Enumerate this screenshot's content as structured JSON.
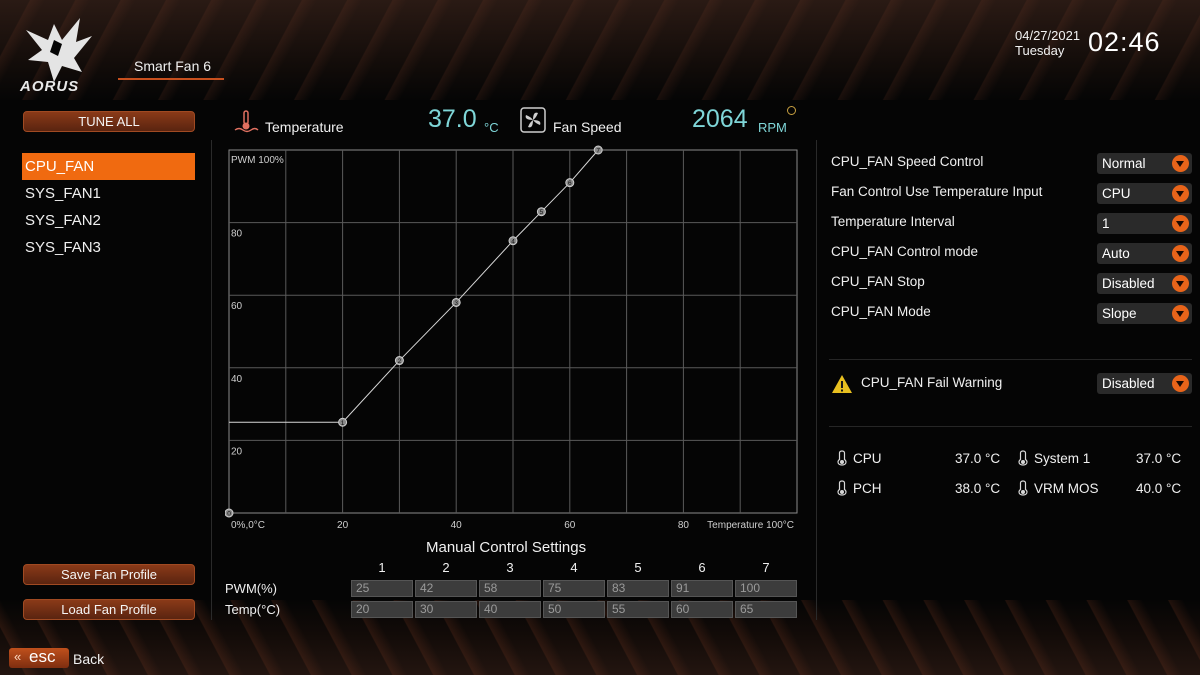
{
  "header": {
    "logo_text": "AORUS",
    "page_tab": "Smart Fan 6",
    "date": "04/27/2021",
    "day": "Tuesday",
    "time": "02:46"
  },
  "left_panel": {
    "tune_all": "TUNE ALL",
    "fans": [
      "CPU_FAN",
      "SYS_FAN1",
      "SYS_FAN2",
      "SYS_FAN3"
    ],
    "selected_fan": "CPU_FAN",
    "save_profile": "Save Fan Profile",
    "load_profile": "Load Fan Profile",
    "esc_label": "esc",
    "back_label": "Back"
  },
  "readings": {
    "temperature_label": "Temperature",
    "temperature_value": "37.0",
    "temperature_unit": "°C",
    "fan_speed_label": "Fan Speed",
    "fan_speed_value": "2064",
    "fan_speed_unit": "RPM"
  },
  "chart_data": {
    "type": "line",
    "x_range": [
      0,
      100
    ],
    "y_range": [
      0,
      100
    ],
    "y_top_label": "PWM 100%",
    "origin_label": "0%,0°C",
    "x_end_label": "Temperature 100°C",
    "x_ticks": [
      "20",
      "40",
      "60",
      "80"
    ],
    "y_ticks": [
      "20",
      "40",
      "60",
      "80"
    ],
    "grid": true,
    "series": [
      {
        "points": [
          {
            "label": "1",
            "x": 20,
            "y": 25
          },
          {
            "label": "2",
            "x": 30,
            "y": 42
          },
          {
            "label": "3",
            "x": 40,
            "y": 58
          },
          {
            "label": "4",
            "x": 50,
            "y": 75
          },
          {
            "label": "5",
            "x": 55,
            "y": 83
          },
          {
            "label": "6",
            "x": 60,
            "y": 91
          },
          {
            "label": "7",
            "x": 65,
            "y": 100
          }
        ],
        "origin_point": {
          "label": "0",
          "x": 0,
          "y": 0
        }
      }
    ]
  },
  "manual_control": {
    "title": "Manual Control Settings",
    "columns": [
      "1",
      "2",
      "3",
      "4",
      "5",
      "6",
      "7"
    ],
    "pwm_label": "PWM(%)",
    "temp_label": "Temp(°C)",
    "pwm_values": [
      "25",
      "42",
      "58",
      "75",
      "83",
      "91",
      "100"
    ],
    "temp_values": [
      "20",
      "30",
      "40",
      "50",
      "55",
      "60",
      "65"
    ]
  },
  "settings": [
    {
      "label": "CPU_FAN Speed Control",
      "value": "Normal"
    },
    {
      "label": "Fan Control Use Temperature Input",
      "value": "CPU"
    },
    {
      "label": "Temperature Interval",
      "value": "1"
    },
    {
      "label": "CPU_FAN Control mode",
      "value": "Auto"
    },
    {
      "label": "CPU_FAN Stop",
      "value": "Disabled"
    },
    {
      "label": "CPU_FAN Mode",
      "value": "Slope"
    }
  ],
  "fail_warning": {
    "label": "CPU_FAN Fail Warning",
    "value": "Disabled"
  },
  "sensors": [
    {
      "label": "CPU",
      "value": "37.0 °C"
    },
    {
      "label": "System 1",
      "value": "37.0 °C"
    },
    {
      "label": "PCH",
      "value": "38.0 °C"
    },
    {
      "label": "VRM MOS",
      "value": "40.0 °C"
    }
  ],
  "colors": {
    "accent": "#f06a10",
    "reading": "#7fd6d8"
  }
}
